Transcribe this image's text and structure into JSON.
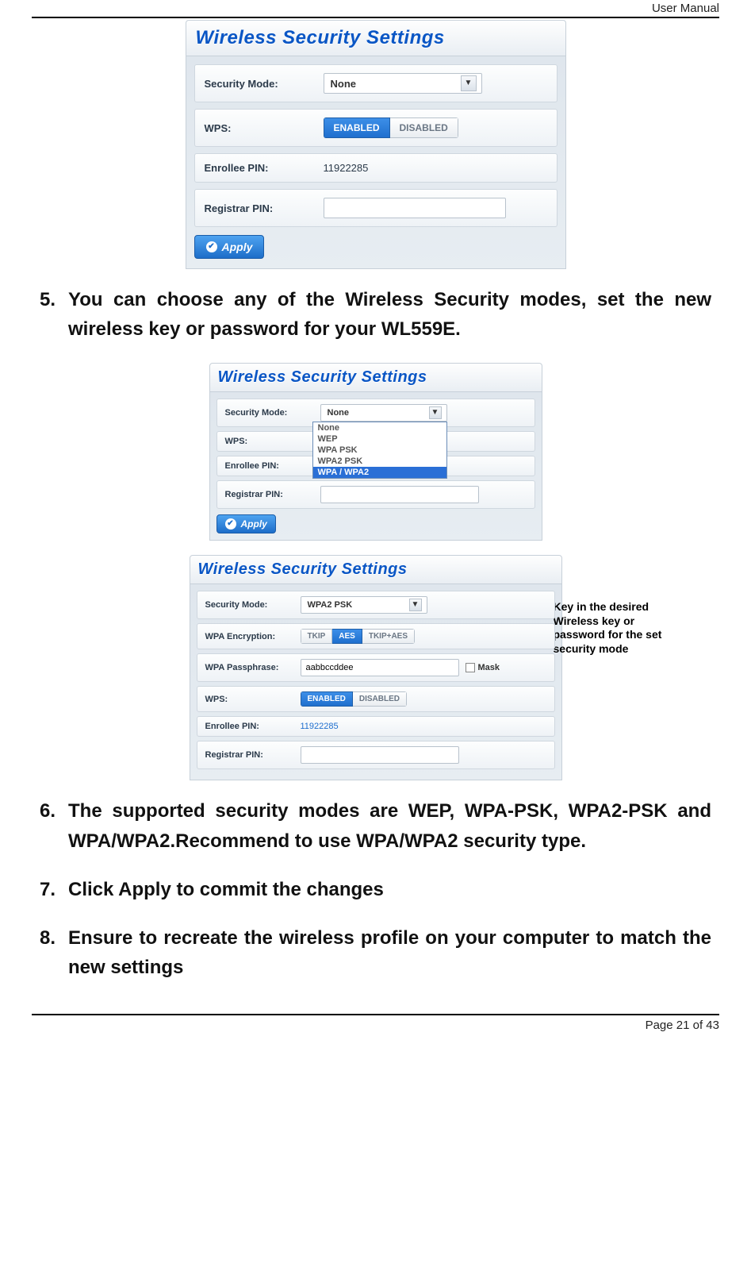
{
  "header": {
    "doc_label": "User Manual"
  },
  "footer": {
    "page_label": "Page 21 of 43"
  },
  "fig1": {
    "title": "Wireless Security Settings",
    "security_mode": {
      "label": "Security Mode:",
      "value": "None"
    },
    "wps": {
      "label": "WPS:",
      "enabled": "ENABLED",
      "disabled": "DISABLED",
      "active": "ENABLED"
    },
    "enrollee": {
      "label": "Enrollee PIN:",
      "value": "11922285"
    },
    "registrar": {
      "label": "Registrar PIN:",
      "value": ""
    },
    "apply": "Apply"
  },
  "step5": {
    "num": "5.",
    "text": "You can choose any of the Wireless Security modes, set the new wireless key or password for your WL559E."
  },
  "fig2": {
    "title": "Wireless Security Settings",
    "security_mode": {
      "label": "Security Mode:",
      "value": "None"
    },
    "options": [
      "None",
      "WEP",
      "WPA PSK",
      "WPA2 PSK",
      "WPA / WPA2"
    ],
    "selected_option": "WPA / WPA2",
    "wps": {
      "label": "WPS:"
    },
    "enrollee": {
      "label": "Enrollee PIN:"
    },
    "registrar": {
      "label": "Registrar PIN:",
      "value": ""
    },
    "apply": "Apply"
  },
  "fig3": {
    "title": "Wireless Security Settings",
    "security_mode": {
      "label": "Security Mode:",
      "value": "WPA2 PSK"
    },
    "encryption": {
      "label": "WPA Encryption:",
      "tkip": "TKIP",
      "aes": "AES",
      "both": "TKIP+AES",
      "active": "AES"
    },
    "passphrase": {
      "label": "WPA Passphrase:",
      "value": "aabbccddee",
      "mask": "Mask"
    },
    "wps": {
      "label": "WPS:",
      "enabled": "ENABLED",
      "disabled": "DISABLED",
      "active": "ENABLED"
    },
    "enrollee": {
      "label": "Enrollee PIN:",
      "value": "11922285"
    },
    "registrar": {
      "label": "Registrar PIN:",
      "value": ""
    },
    "annotation": "Key in the desired Wireless key or password for the set security mode"
  },
  "step6": {
    "num": "6.",
    "text": "The supported security modes are WEP, WPA-PSK, WPA2-PSK and WPA/WPA2.Recommend to use WPA/WPA2 security type."
  },
  "step7": {
    "num": "7.",
    "text": "Click Apply to commit the changes"
  },
  "step8": {
    "num": "8.",
    "text": "Ensure to recreate the wireless profile on your computer to match the new settings"
  }
}
